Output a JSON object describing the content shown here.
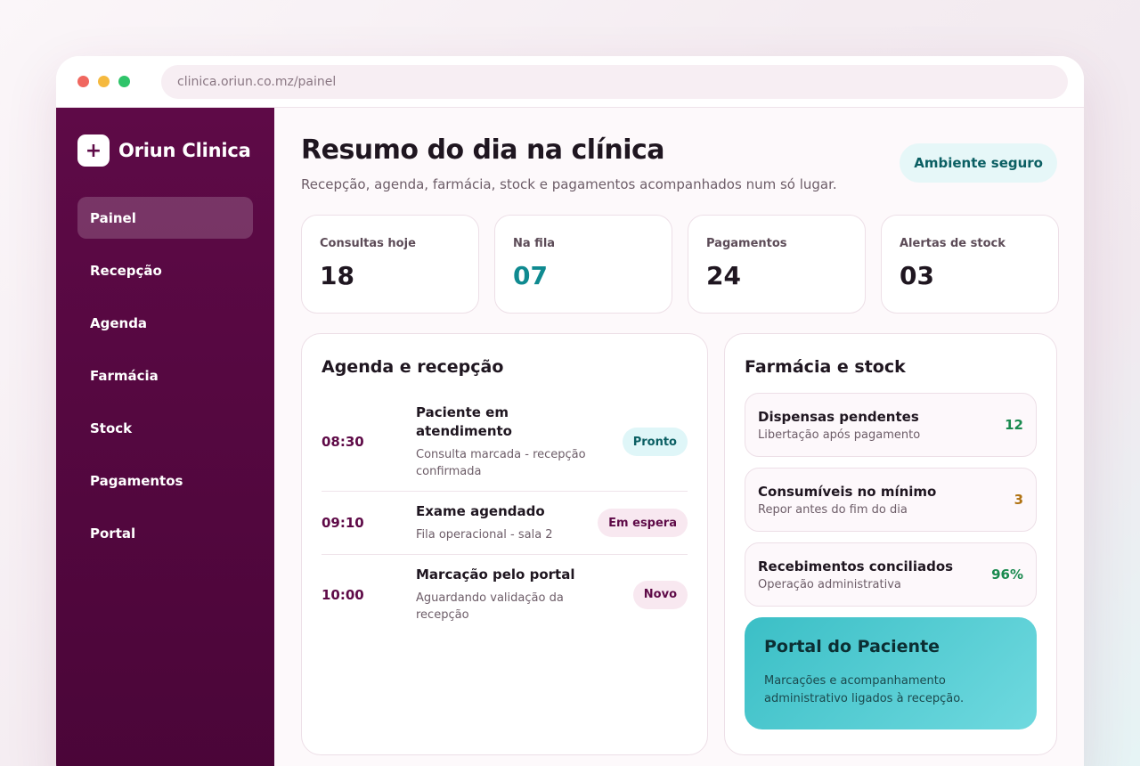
{
  "browser": {
    "url": "clinica.oriun.co.mz/painel"
  },
  "brand": {
    "icon": "+",
    "name": "Oriun Clinica"
  },
  "nav": [
    {
      "label": "Painel",
      "active": true
    },
    {
      "label": "Recepção"
    },
    {
      "label": "Agenda"
    },
    {
      "label": "Farmácia"
    },
    {
      "label": "Stock"
    },
    {
      "label": "Pagamentos"
    },
    {
      "label": "Portal"
    }
  ],
  "header": {
    "title": "Resumo do dia na clínica",
    "subtitle": "Recepção, agenda, farmácia, stock e pagamentos acompanhados num só lugar.",
    "badge": "Ambiente seguro"
  },
  "stats": [
    {
      "label": "Consultas hoje",
      "value": "18"
    },
    {
      "label": "Na fila",
      "value": "07"
    },
    {
      "label": "Pagamentos",
      "value": "24"
    },
    {
      "label": "Alertas de stock",
      "value": "03"
    }
  ],
  "agenda": {
    "title": "Agenda e recepção",
    "rows": [
      {
        "time": "08:30",
        "title": "Paciente em atendimento",
        "desc": "Consulta marcada - recepção confirmada",
        "badge": "Pronto"
      },
      {
        "time": "09:10",
        "title": "Exame agendado",
        "desc": "Fila operacional - sala 2",
        "badge": "Em espera"
      },
      {
        "time": "10:00",
        "title": "Marcação pelo portal",
        "desc": "Aguardando validação da recepção",
        "badge": "Novo"
      }
    ]
  },
  "pharmacy": {
    "title": "Farmácia e stock",
    "items": [
      {
        "title": "Dispensas pendentes",
        "desc": "Libertação após pagamento",
        "value": "12"
      },
      {
        "title": "Consumíveis no mínimo",
        "desc": "Repor antes do fim do dia",
        "value": "3"
      },
      {
        "title": "Recebimentos conciliados",
        "desc": "Operação administrativa",
        "value": "96%"
      }
    ]
  },
  "portal": {
    "title": "Portal do Paciente",
    "desc": "Marcações e acompanhamento administrativo ligados à recepção."
  },
  "colors": {
    "sidebar": "#5e0a47",
    "accent_teal": "#0f8a90",
    "portal": "#3bbfc6"
  }
}
